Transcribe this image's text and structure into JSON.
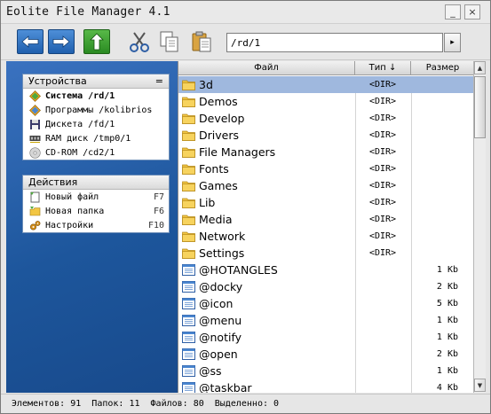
{
  "window": {
    "title": "Eolite File Manager 4.1",
    "minimize_glyph": "_",
    "close_glyph": "×"
  },
  "toolbar": {
    "path": "/rd/1",
    "go_glyph": "▸",
    "buttons": [
      "back",
      "forward",
      "up",
      "cut",
      "copy",
      "paste"
    ]
  },
  "devices": {
    "title": "Устройства",
    "menu_glyph": "=",
    "items": [
      {
        "label": "Система /rd/1",
        "icon": "system-diamond-icon",
        "bold": true
      },
      {
        "label": "Программы /kolibrios",
        "icon": "programs-diamond-icon",
        "bold": false
      },
      {
        "label": "Дискета /fd/1",
        "icon": "floppy-icon",
        "bold": false
      },
      {
        "label": "RAM диск /tmp0/1",
        "icon": "ram-icon",
        "bold": false
      },
      {
        "label": "CD-ROM /cd2/1",
        "icon": "cdrom-icon",
        "bold": false
      }
    ]
  },
  "actions": {
    "title": "Действия",
    "items": [
      {
        "label": "Новый файл",
        "key": "F7",
        "icon": "new-file-icon"
      },
      {
        "label": "Новая папка",
        "key": "F6",
        "icon": "new-folder-icon"
      },
      {
        "label": "Настройки",
        "key": "F10",
        "icon": "settings-gears-icon"
      }
    ]
  },
  "columns": {
    "name": "Файл",
    "type": "Тип ↓",
    "size": "Размер"
  },
  "files": [
    {
      "name": "3d",
      "type": "<DIR>",
      "size": "",
      "kind": "folder",
      "selected": true
    },
    {
      "name": "Demos",
      "type": "<DIR>",
      "size": "",
      "kind": "folder"
    },
    {
      "name": "Develop",
      "type": "<DIR>",
      "size": "",
      "kind": "folder"
    },
    {
      "name": "Drivers",
      "type": "<DIR>",
      "size": "",
      "kind": "folder"
    },
    {
      "name": "File Managers",
      "type": "<DIR>",
      "size": "",
      "kind": "folder"
    },
    {
      "name": "Fonts",
      "type": "<DIR>",
      "size": "",
      "kind": "folder"
    },
    {
      "name": "Games",
      "type": "<DIR>",
      "size": "",
      "kind": "folder"
    },
    {
      "name": "Lib",
      "type": "<DIR>",
      "size": "",
      "kind": "folder"
    },
    {
      "name": "Media",
      "type": "<DIR>",
      "size": "",
      "kind": "folder"
    },
    {
      "name": "Network",
      "type": "<DIR>",
      "size": "",
      "kind": "folder"
    },
    {
      "name": "Settings",
      "type": "<DIR>",
      "size": "",
      "kind": "folder"
    },
    {
      "name": "@HOTANGLES",
      "type": "",
      "size": "1 Kb",
      "kind": "app"
    },
    {
      "name": "@docky",
      "type": "",
      "size": "2 Kb",
      "kind": "app"
    },
    {
      "name": "@icon",
      "type": "",
      "size": "5 Kb",
      "kind": "app"
    },
    {
      "name": "@menu",
      "type": "",
      "size": "1 Kb",
      "kind": "app"
    },
    {
      "name": "@notify",
      "type": "",
      "size": "1 Kb",
      "kind": "app"
    },
    {
      "name": "@open",
      "type": "",
      "size": "2 Kb",
      "kind": "app"
    },
    {
      "name": "@ss",
      "type": "",
      "size": "1 Kb",
      "kind": "app"
    },
    {
      "name": "@taskbar",
      "type": "",
      "size": "4 Kb",
      "kind": "app"
    }
  ],
  "status": {
    "text": "Элементов: 91  Папок: 11  Файлов: 80  Выделенно: 0"
  },
  "colors": {
    "panel_blue": "#1d569c",
    "selection": "#9fb8de",
    "folder_yellow": "#f2c643"
  }
}
